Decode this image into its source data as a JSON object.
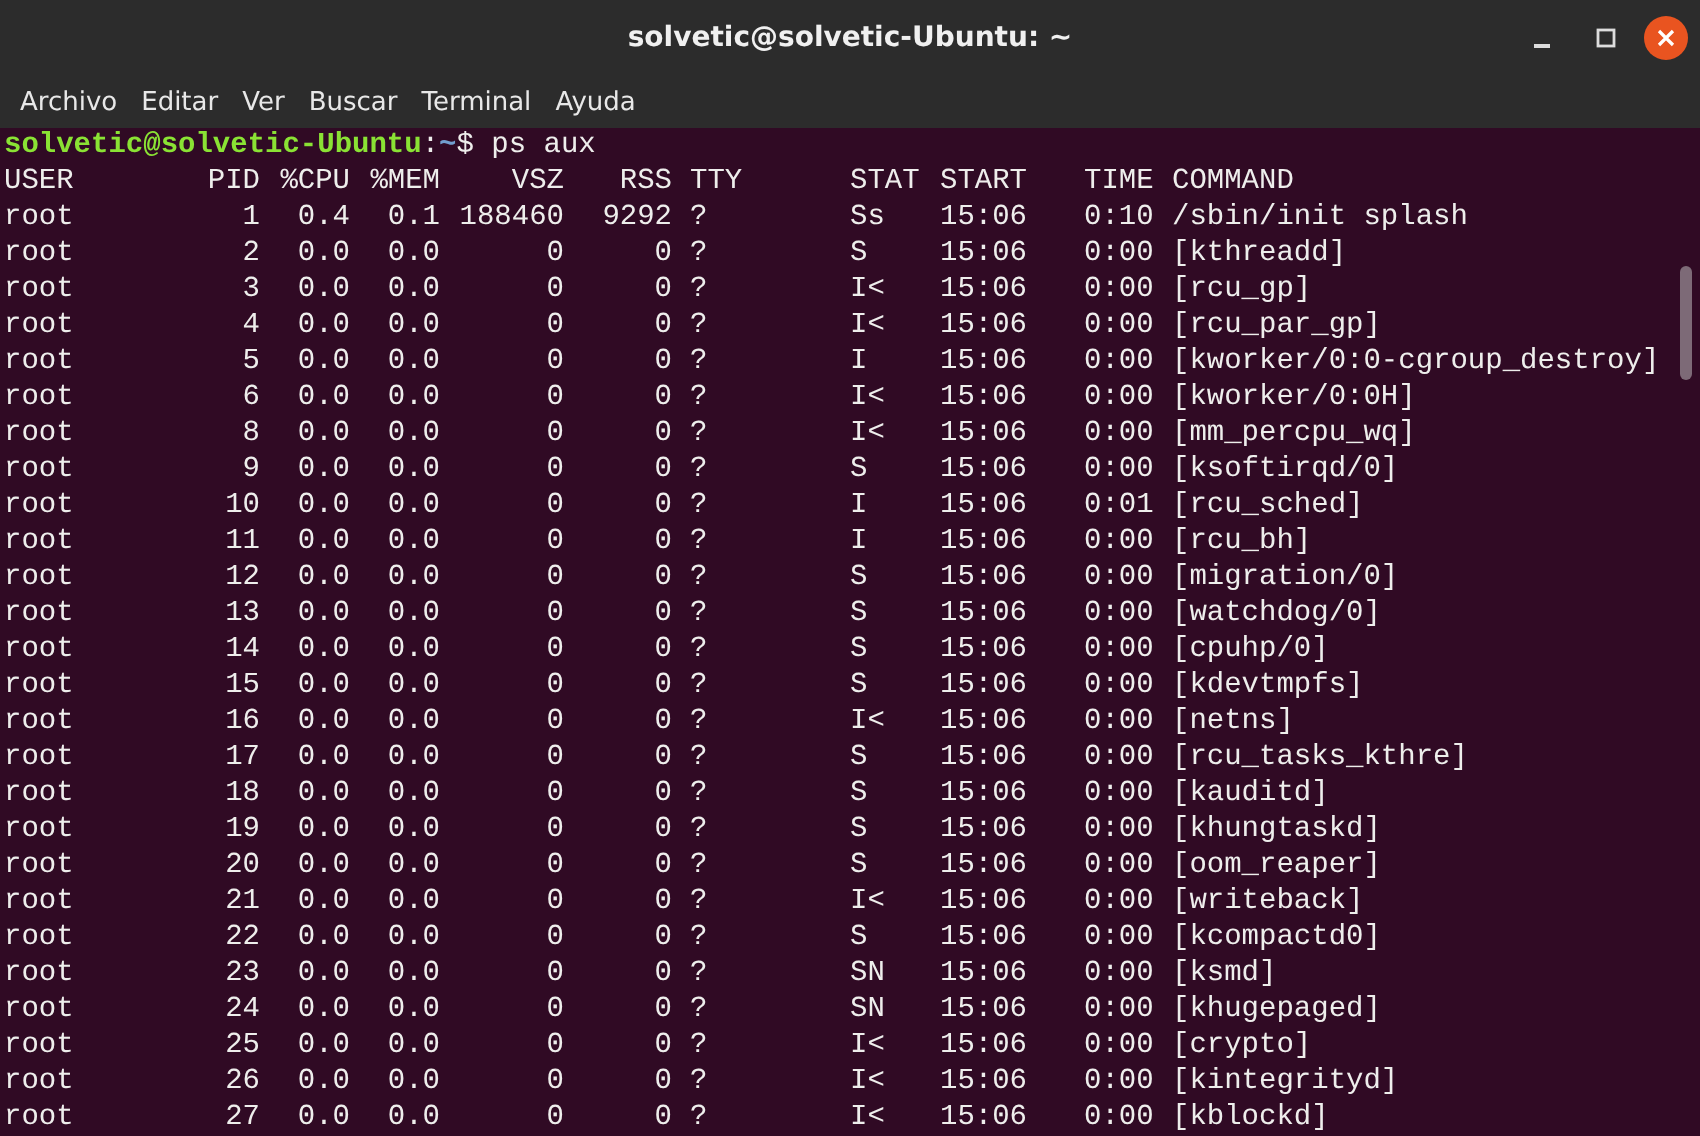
{
  "window": {
    "title": "solvetic@solvetic-Ubuntu: ~"
  },
  "menu": [
    "Archivo",
    "Editar",
    "Ver",
    "Buscar",
    "Terminal",
    "Ayuda"
  ],
  "prompt": {
    "user_host": "solvetic@solvetic-Ubuntu",
    "separator": ":",
    "path": "~",
    "symbol": "$",
    "command": "ps aux"
  },
  "table": {
    "columns": [
      "USER",
      "PID",
      "%CPU",
      "%MEM",
      "VSZ",
      "RSS",
      "TTY",
      "STAT",
      "START",
      "TIME",
      "COMMAND"
    ],
    "rows": [
      [
        "root",
        "1",
        "0.4",
        "0.1",
        "188460",
        "9292",
        "?",
        "Ss",
        "15:06",
        "0:10",
        "/sbin/init splash"
      ],
      [
        "root",
        "2",
        "0.0",
        "0.0",
        "0",
        "0",
        "?",
        "S",
        "15:06",
        "0:00",
        "[kthreadd]"
      ],
      [
        "root",
        "3",
        "0.0",
        "0.0",
        "0",
        "0",
        "?",
        "I<",
        "15:06",
        "0:00",
        "[rcu_gp]"
      ],
      [
        "root",
        "4",
        "0.0",
        "0.0",
        "0",
        "0",
        "?",
        "I<",
        "15:06",
        "0:00",
        "[rcu_par_gp]"
      ],
      [
        "root",
        "5",
        "0.0",
        "0.0",
        "0",
        "0",
        "?",
        "I",
        "15:06",
        "0:00",
        "[kworker/0:0-cgroup_destroy]"
      ],
      [
        "root",
        "6",
        "0.0",
        "0.0",
        "0",
        "0",
        "?",
        "I<",
        "15:06",
        "0:00",
        "[kworker/0:0H]"
      ],
      [
        "root",
        "8",
        "0.0",
        "0.0",
        "0",
        "0",
        "?",
        "I<",
        "15:06",
        "0:00",
        "[mm_percpu_wq]"
      ],
      [
        "root",
        "9",
        "0.0",
        "0.0",
        "0",
        "0",
        "?",
        "S",
        "15:06",
        "0:00",
        "[ksoftirqd/0]"
      ],
      [
        "root",
        "10",
        "0.0",
        "0.0",
        "0",
        "0",
        "?",
        "I",
        "15:06",
        "0:01",
        "[rcu_sched]"
      ],
      [
        "root",
        "11",
        "0.0",
        "0.0",
        "0",
        "0",
        "?",
        "I",
        "15:06",
        "0:00",
        "[rcu_bh]"
      ],
      [
        "root",
        "12",
        "0.0",
        "0.0",
        "0",
        "0",
        "?",
        "S",
        "15:06",
        "0:00",
        "[migration/0]"
      ],
      [
        "root",
        "13",
        "0.0",
        "0.0",
        "0",
        "0",
        "?",
        "S",
        "15:06",
        "0:00",
        "[watchdog/0]"
      ],
      [
        "root",
        "14",
        "0.0",
        "0.0",
        "0",
        "0",
        "?",
        "S",
        "15:06",
        "0:00",
        "[cpuhp/0]"
      ],
      [
        "root",
        "15",
        "0.0",
        "0.0",
        "0",
        "0",
        "?",
        "S",
        "15:06",
        "0:00",
        "[kdevtmpfs]"
      ],
      [
        "root",
        "16",
        "0.0",
        "0.0",
        "0",
        "0",
        "?",
        "I<",
        "15:06",
        "0:00",
        "[netns]"
      ],
      [
        "root",
        "17",
        "0.0",
        "0.0",
        "0",
        "0",
        "?",
        "S",
        "15:06",
        "0:00",
        "[rcu_tasks_kthre]"
      ],
      [
        "root",
        "18",
        "0.0",
        "0.0",
        "0",
        "0",
        "?",
        "S",
        "15:06",
        "0:00",
        "[kauditd]"
      ],
      [
        "root",
        "19",
        "0.0",
        "0.0",
        "0",
        "0",
        "?",
        "S",
        "15:06",
        "0:00",
        "[khungtaskd]"
      ],
      [
        "root",
        "20",
        "0.0",
        "0.0",
        "0",
        "0",
        "?",
        "S",
        "15:06",
        "0:00",
        "[oom_reaper]"
      ],
      [
        "root",
        "21",
        "0.0",
        "0.0",
        "0",
        "0",
        "?",
        "I<",
        "15:06",
        "0:00",
        "[writeback]"
      ],
      [
        "root",
        "22",
        "0.0",
        "0.0",
        "0",
        "0",
        "?",
        "S",
        "15:06",
        "0:00",
        "[kcompactd0]"
      ],
      [
        "root",
        "23",
        "0.0",
        "0.0",
        "0",
        "0",
        "?",
        "SN",
        "15:06",
        "0:00",
        "[ksmd]"
      ],
      [
        "root",
        "24",
        "0.0",
        "0.0",
        "0",
        "0",
        "?",
        "SN",
        "15:06",
        "0:00",
        "[khugepaged]"
      ],
      [
        "root",
        "25",
        "0.0",
        "0.0",
        "0",
        "0",
        "?",
        "I<",
        "15:06",
        "0:00",
        "[crypto]"
      ],
      [
        "root",
        "26",
        "0.0",
        "0.0",
        "0",
        "0",
        "?",
        "I<",
        "15:06",
        "0:00",
        "[kintegrityd]"
      ],
      [
        "root",
        "27",
        "0.0",
        "0.0",
        "0",
        "0",
        "?",
        "I<",
        "15:06",
        "0:00",
        "[kblockd]"
      ]
    ]
  }
}
